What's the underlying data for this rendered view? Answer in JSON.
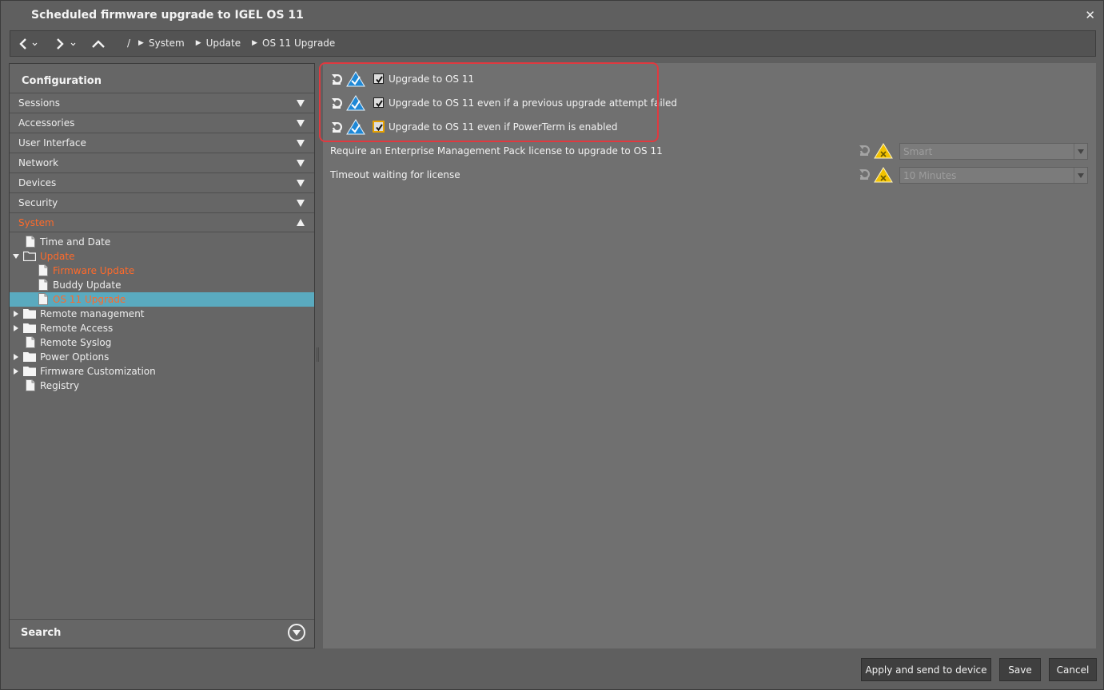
{
  "window": {
    "title": "Scheduled firmware upgrade to IGEL OS 11",
    "close_glyph": "✕"
  },
  "breadcrumb": {
    "root": "/",
    "items": [
      "System",
      "Update",
      "OS 11 Upgrade"
    ]
  },
  "left_panel": {
    "title": "Configuration",
    "categories": [
      {
        "label": "Sessions",
        "expanded": false
      },
      {
        "label": "Accessories",
        "expanded": false
      },
      {
        "label": "User Interface",
        "expanded": false
      },
      {
        "label": "Network",
        "expanded": false
      },
      {
        "label": "Devices",
        "expanded": false
      },
      {
        "label": "Security",
        "expanded": false
      },
      {
        "label": "System",
        "expanded": true
      }
    ],
    "tree": [
      {
        "label": "Time and Date"
      },
      {
        "label": "Update"
      },
      {
        "label": "Firmware Update"
      },
      {
        "label": "Buddy Update"
      },
      {
        "label": "OS 11 Upgrade"
      },
      {
        "label": "Remote management"
      },
      {
        "label": "Remote Access"
      },
      {
        "label": "Remote Syslog"
      },
      {
        "label": "Power Options"
      },
      {
        "label": "Firmware Customization"
      },
      {
        "label": "Registry"
      }
    ],
    "search_label": "Search"
  },
  "settings": {
    "checkboxes": [
      {
        "label": "Upgrade to OS 11",
        "checked": true
      },
      {
        "label": "Upgrade to OS 11 even if a previous upgrade attempt failed",
        "checked": true
      },
      {
        "label": "Upgrade to OS 11 even if PowerTerm is enabled",
        "checked": true
      }
    ],
    "license": {
      "label": "Require an Enterprise Management Pack license to upgrade to OS 11",
      "value": "Smart"
    },
    "timeout": {
      "label": "Timeout waiting for license",
      "value": "10 Minutes"
    }
  },
  "footer": {
    "apply_label": "Apply and send to device",
    "save_label": "Save",
    "cancel_label": "Cancel"
  },
  "colors": {
    "accent_orange": "#ff6a2a",
    "selection": "#5aaabf",
    "highlight_border": "#e0393f",
    "state_blue": "#1e88d6",
    "warning_yellow": "#f2c200"
  }
}
